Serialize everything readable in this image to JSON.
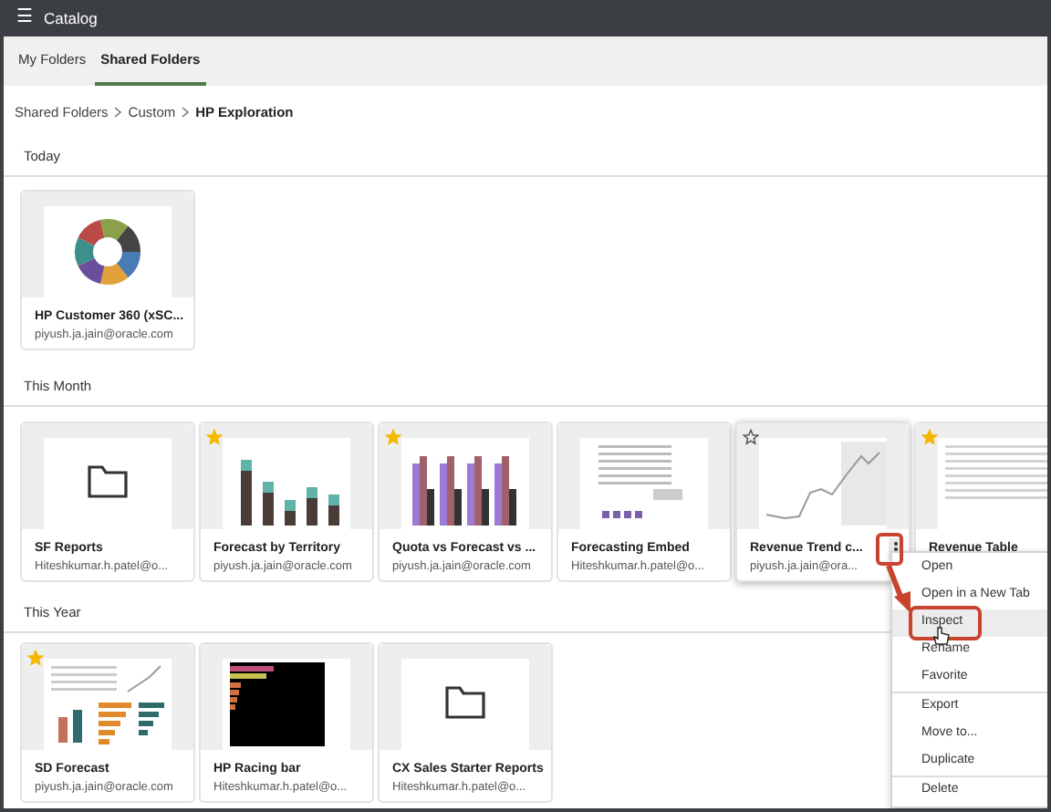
{
  "header": {
    "menu_icon": "☰",
    "title": "Catalog"
  },
  "tabs": [
    {
      "label": "My Folders",
      "selected": false
    },
    {
      "label": "Shared Folders",
      "selected": true
    }
  ],
  "breadcrumb": [
    {
      "label": "Shared Folders",
      "current": false
    },
    {
      "label": "Custom",
      "current": false
    },
    {
      "label": "HP Exploration",
      "current": true
    }
  ],
  "sections": [
    {
      "title": "Today",
      "items": [
        {
          "title": "HP Customer 360 (xSC...",
          "owner": "piyush.ja.jain@oracle.com",
          "kind": "donut",
          "favorite": false,
          "menu_open": false
        }
      ]
    },
    {
      "title": "This Month",
      "items": [
        {
          "title": "SF Reports",
          "owner": "Hiteshkumar.h.patel@o...",
          "kind": "folder",
          "favorite": false,
          "menu_open": false
        },
        {
          "title": "Forecast by Territory",
          "owner": "piyush.ja.jain@oracle.com",
          "kind": "stacked-bar",
          "favorite": true,
          "menu_open": false
        },
        {
          "title": "Quota vs Forecast vs ...",
          "owner": "piyush.ja.jain@oracle.com",
          "kind": "grouped-bar",
          "favorite": true,
          "menu_open": false
        },
        {
          "title": "Forecasting Embed",
          "owner": "Hiteshkumar.h.patel@o...",
          "kind": "report",
          "favorite": false,
          "menu_open": false
        },
        {
          "title": "Revenue Trend c...",
          "owner": "piyush.ja.jain@ora...",
          "kind": "line",
          "favorite": false,
          "menu_open": true
        },
        {
          "title": "Revenue Table",
          "kind": "table",
          "favorite": true,
          "menu_open": false
        }
      ]
    },
    {
      "title": "This Year",
      "items": [
        {
          "title": "SD Forecast",
          "owner": "piyush.ja.jain@oracle.com",
          "kind": "dashboard",
          "favorite": true,
          "menu_open": false
        },
        {
          "title": "HP Racing bar",
          "owner": "Hiteshkumar.h.patel@o...",
          "kind": "racing",
          "favorite": false,
          "menu_open": false
        },
        {
          "title": "CX Sales Starter Reports",
          "owner": "Hiteshkumar.h.patel@o...",
          "kind": "folder",
          "favorite": false,
          "menu_open": false
        }
      ]
    }
  ],
  "context_menu": [
    {
      "label": "Open",
      "selected": false,
      "divider_after": false
    },
    {
      "label": "Open in a New Tab",
      "selected": false,
      "divider_after": false
    },
    {
      "label": "Inspect",
      "selected": true,
      "divider_after": false
    },
    {
      "label": "Rename",
      "selected": false,
      "divider_after": false
    },
    {
      "label": "Favorite",
      "selected": false,
      "divider_after": true
    },
    {
      "label": "Export",
      "selected": false,
      "divider_after": false
    },
    {
      "label": "Move to...",
      "selected": false,
      "divider_after": false
    },
    {
      "label": "Duplicate",
      "selected": false,
      "divider_after": true
    },
    {
      "label": "Delete",
      "selected": false,
      "divider_after": false
    }
  ]
}
